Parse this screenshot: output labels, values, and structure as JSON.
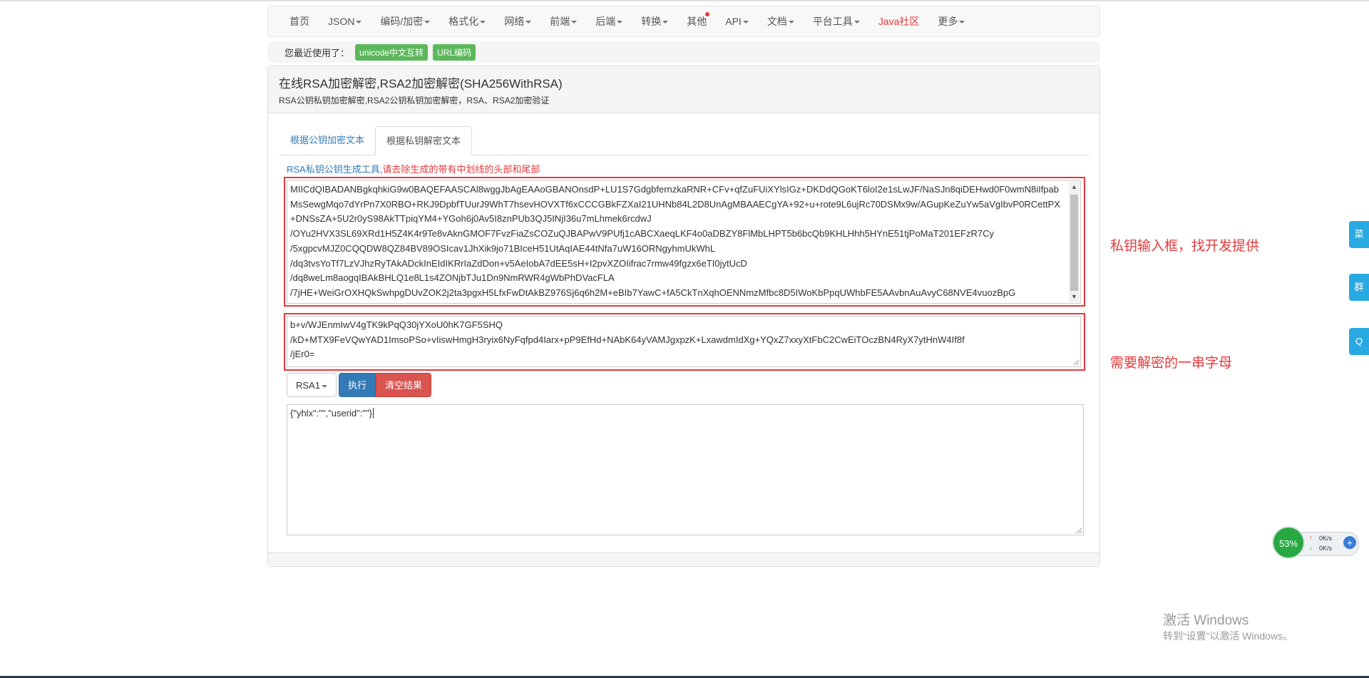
{
  "nav": {
    "items": [
      {
        "label": "首页",
        "dropdown": false
      },
      {
        "label": "JSON",
        "dropdown": true
      },
      {
        "label": "编码/加密",
        "dropdown": true
      },
      {
        "label": "格式化",
        "dropdown": true
      },
      {
        "label": "网络",
        "dropdown": true
      },
      {
        "label": "前端",
        "dropdown": true
      },
      {
        "label": "后端",
        "dropdown": true
      },
      {
        "label": "转换",
        "dropdown": true
      },
      {
        "label": "其他",
        "dropdown": false
      },
      {
        "label": "API",
        "dropdown": true
      },
      {
        "label": "文档",
        "dropdown": true
      },
      {
        "label": "平台工具",
        "dropdown": true
      },
      {
        "label": "Java社区",
        "dropdown": false
      },
      {
        "label": "更多",
        "dropdown": true
      }
    ]
  },
  "recent": {
    "label": "您最近使用了：",
    "tags": [
      "unicode中文互转",
      "URL编码"
    ]
  },
  "panel": {
    "title": "在线RSA加密解密,RSA2加密解密(SHA256WithRSA)",
    "subtitle": "RSA公钥私钥加密解密,RSA2公钥私钥加密解密，RSA、RSA2加密验证"
  },
  "tabs": {
    "encrypt": "根据公钥加密文本",
    "decrypt": "根据私钥解密文本"
  },
  "linkline": {
    "link": "RSA私钥公钥生成工具,",
    "warning": "请去除生成的带有中划线的头部和尾部"
  },
  "private_key": {
    "value": "MIICdQIBADANBgkqhkiG9w0BAQEFAASCAl8wggJbAgEAAoGBANOnsdP+LU1S7GdgbfernzkaRNR+CFv+qfZuFUiXYlsIGz+DKDdQGoKT6loI2e1sLwJF/NaSJn8qiDEHwd0F0wmN8iIfpabMsSewgMqo7dYrPn7X0RBO+RKJ9DpbfTUurJ9WhT7hsevHOVXTf6xCCCGBkFZXaI21UHNb84L2D8UnAgMBAAECgYA+92+u+rote9L6ujRc70DSMx9w/AGupKeZuYw5aVgIbvP0RCettPX+DNSsZA+5U2r0yS98AkTTpiqYM4+YGoh6j0Av5I8znPUb3QJ5INjI36u7mLhmek6rcdwJ\n/OYu2HVX3SL69XRd1H5Z4K4r9Te8vAknGMOF7FvzFiaZsCOZuQJBAPwV9PUfj1cABCXaeqLKF4o0aDBZY8FlMbLHPT5b6bcQb9KHLHhh5HYnE51tjPoMaT201EFzR7Cy\n/5xgpcvMJZ0CQQDW8QZ84BV89OSIcav1JhXik9jo71BIceH51UtAqIAE44tNfa7uW16ORNgyhmUkWhL\n/dq3tvsYoTf7LzVJhzRyTAkADckInEIdIKRrIaZdDon+v5AeIobA7dEE5sH+I2pvXZOIifrac7rmw49fgzx6eTI0jytUcD\n/dq8weLm8aogqIBAkBHLQ1e8L1s4ZONjbTJu1Dn9NmRWR4gWbPhDVacFLA\n/7jHE+WeiGrOXHQkSwhpgDUvZOK2j2ta3pgxH5LfxFwDtAkBZ976Sj6q6h2M+eBIb7YawC+fA5CkTnXqhOENNmzMfbc8D5IWoKbPpqUWhbFE5AAvbnAuAvyC68NVE4vuozBpG"
  },
  "cipher": {
    "value": "b+v/WJEnmIwV4gTK9kPqQ30jYXoU0hK7GF5SHQ\n/kD+MTX9FeVQwYAD1ImsoPSo+vIiswHmgH3ryix6NyFqfpd4Iarx+pP9EfHd+NAbK64yVAMJgxpzK+LxawdmIdXg+YQxZ7xxyXtFbC2CwEiTOczBN4RyX7ytHnW4If8f\n/jEr0="
  },
  "buttons": {
    "algo": "RSA1",
    "run": "执行",
    "clear": "清空结果"
  },
  "result": {
    "value": "{\"yhlx\":\"\",\"userid\":\"\"}"
  },
  "annotations": {
    "note1": "私钥输入框，找开发提供",
    "note2": "需要解密的一串字母"
  },
  "float_tabs": [
    "菜",
    "群",
    "Q"
  ],
  "net_widget": {
    "percent": "53%",
    "up": "0K/s",
    "down": "0K/s"
  },
  "watermark": {
    "line1": "激活 Windows",
    "line2": "转到“设置”以激活 Windows。"
  },
  "colors": {
    "accent_red": "#e4393c",
    "link_blue": "#337ab7",
    "tag_green": "#5cb85c",
    "float_blue": "#29a9e1"
  }
}
